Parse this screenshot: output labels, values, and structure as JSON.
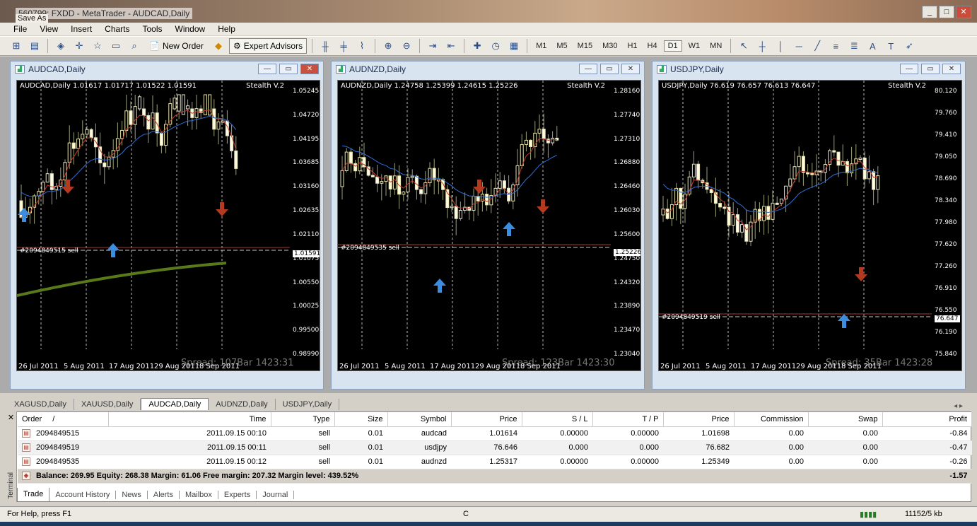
{
  "window": {
    "title": "560799: FXDD - MetaTrader - AUDCAD,Daily",
    "saveas": "Save As"
  },
  "menu": [
    "File",
    "View",
    "Insert",
    "Charts",
    "Tools",
    "Window",
    "Help"
  ],
  "toolbar": {
    "new_order": "New Order",
    "expert_advisors": "Expert Advisors",
    "timeframes": [
      "M1",
      "M5",
      "M15",
      "M30",
      "H1",
      "H4",
      "D1",
      "W1",
      "MN"
    ],
    "selected_tf": "D1"
  },
  "charts": [
    {
      "title": "AUDCAD,Daily",
      "header": "AUDCAD,Daily  1.01617 1.01717 1.01522 1.01591",
      "indicator": "Stealth V.2",
      "order_label": "#2094849515 sell",
      "spread": "Spread: 107Bar  1423:31",
      "yticks": [
        "1.05245",
        "1.04720",
        "1.04195",
        "1.03685",
        "1.03160",
        "1.02635",
        "1.02110",
        "1.01075",
        "1.00550",
        "1.00025",
        "0.99500",
        "0.98990"
      ],
      "last": "1.01591",
      "xticks": [
        "26 Jul 2011",
        "5 Aug 2011",
        "17 Aug 2011",
        "29 Aug 2011",
        "8 Sep 2011"
      ],
      "chart_data": {
        "type": "line",
        "title": "AUDCAD,Daily",
        "ylim": [
          0.9899,
          1.05245
        ],
        "last_close": 1.01591
      }
    },
    {
      "title": "AUDNZD,Daily",
      "header": "AUDNZD,Daily  1.24758 1.25399 1.24615 1.25226",
      "indicator": "Stealth V.2",
      "order_label": "#2094849535 sell",
      "spread": "Spread: 123Bar  1423:30",
      "yticks": [
        "1.28160",
        "1.27740",
        "1.27310",
        "1.26880",
        "1.26460",
        "1.26030",
        "1.25600",
        "1.24750",
        "1.24320",
        "1.23890",
        "1.23470",
        "1.23040"
      ],
      "last": "1.25226",
      "xticks": [
        "26 Jul 2011",
        "5 Aug 2011",
        "17 Aug 2011",
        "29 Aug 2011",
        "8 Sep 2011"
      ],
      "chart_data": {
        "type": "line",
        "title": "AUDNZD,Daily",
        "ylim": [
          1.2304,
          1.2816
        ],
        "last_close": 1.25226
      }
    },
    {
      "title": "USDJPY,Daily",
      "header": "USDJPY,Daily  76.619 76.657 76.613 76.647",
      "indicator": "Stealth V.2",
      "order_label": "#2094849519 sell",
      "spread": "Spread: 35Bar  1423:28",
      "yticks": [
        "80.120",
        "79.760",
        "79.410",
        "79.050",
        "78.690",
        "78.340",
        "77.980",
        "77.620",
        "77.260",
        "76.910",
        "76.550",
        "76.190",
        "75.840"
      ],
      "last": "76.647",
      "xticks": [
        "26 Jul 2011",
        "5 Aug 2011",
        "17 Aug 2011",
        "29 Aug 2011",
        "8 Sep 2011"
      ],
      "chart_data": {
        "type": "line",
        "title": "USDJPY,Daily",
        "ylim": [
          75.84,
          80.12
        ],
        "last_close": 76.647
      }
    }
  ],
  "symtabs": [
    "XAGUSD,Daily",
    "XAUUSD,Daily",
    "AUDCAD,Daily",
    "AUDNZD,Daily",
    "USDJPY,Daily"
  ],
  "active_symtab": "AUDCAD,Daily",
  "terminal": {
    "columns": [
      "Order",
      "/",
      "Time",
      "Type",
      "Size",
      "Symbol",
      "Price",
      "S / L",
      "T / P",
      "Price",
      "Commission",
      "Swap",
      "Profit"
    ],
    "rows": [
      {
        "order": "2094849515",
        "time": "2011.09.15 00:10",
        "type": "sell",
        "size": "0.01",
        "symbol": "audcad",
        "price": "1.01614",
        "sl": "0.00000",
        "tp": "0.00000",
        "cur": "1.01698",
        "comm": "0.00",
        "swap": "0.00",
        "profit": "-0.84"
      },
      {
        "order": "2094849519",
        "time": "2011.09.15 00:11",
        "type": "sell",
        "size": "0.01",
        "symbol": "usdjpy",
        "price": "76.646",
        "sl": "0.000",
        "tp": "0.000",
        "cur": "76.682",
        "comm": "0.00",
        "swap": "0.00",
        "profit": "-0.47"
      },
      {
        "order": "2094849535",
        "time": "2011.09.15 00:12",
        "type": "sell",
        "size": "0.01",
        "symbol": "audnzd",
        "price": "1.25317",
        "sl": "0.00000",
        "tp": "0.00000",
        "cur": "1.25349",
        "comm": "0.00",
        "swap": "0.00",
        "profit": "-0.26"
      }
    ],
    "balance": "Balance: 269.95  Equity: 268.38  Margin: 61.06  Free margin: 207.32  Margin level: 439.52%",
    "total": "-1.57",
    "side_label": "Terminal",
    "tabs": [
      "Trade",
      "Account History",
      "News",
      "Alerts",
      "Mailbox",
      "Experts",
      "Journal"
    ],
    "active_tab": "Trade"
  },
  "status": {
    "help": "For Help, press F1",
    "c": "C",
    "traffic": "11152/5 kb"
  }
}
